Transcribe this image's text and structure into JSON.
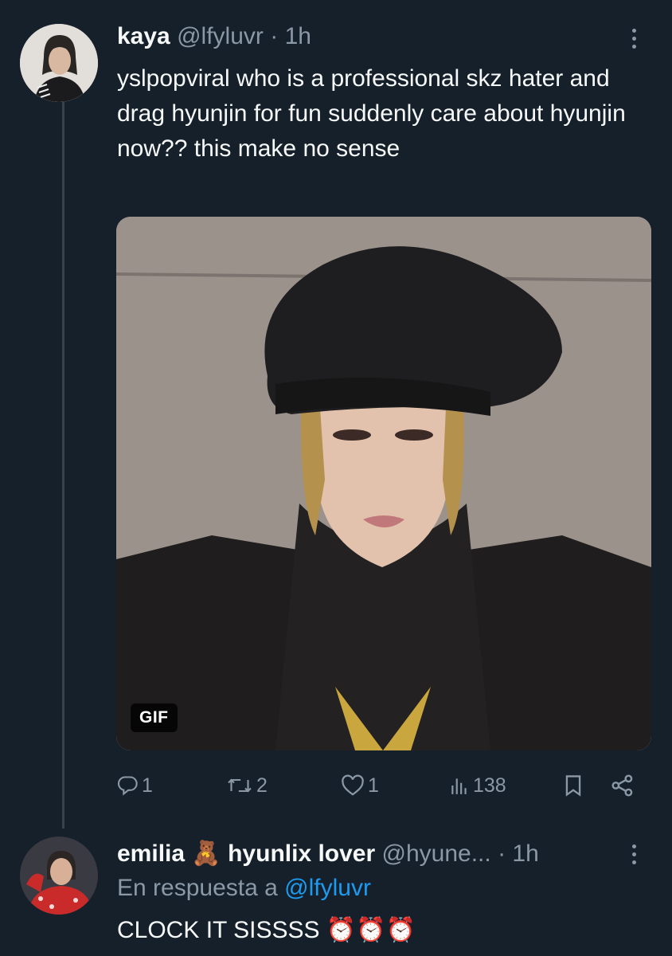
{
  "tweet1": {
    "name": "kaya",
    "handle": "@lfyluvr",
    "separator": "·",
    "time": "1h",
    "text": "yslpopviral who is a professional skz hater and drag hyunjin for fun suddenly care about hyunjin now?? this make no sense",
    "media_badge": "GIF",
    "actions": {
      "replies": "1",
      "reposts": "2",
      "likes": "1",
      "views": "138"
    }
  },
  "tweet2": {
    "name": "emilia",
    "name_emoji": "🧸",
    "name_suffix": "hyunlix lover",
    "handle": "@hyune...",
    "separator": "·",
    "time": "1h",
    "reply_prefix": "En respuesta a",
    "reply_to": "@lfyluvr",
    "text": "CLOCK IT SISSSS",
    "emojis": "⏰⏰⏰"
  },
  "icons": {
    "reply": "reply-icon",
    "repost": "repost-icon",
    "like": "heart-icon",
    "views": "views-icon",
    "bookmark": "bookmark-icon",
    "share": "share-icon",
    "more": "more-icon"
  },
  "colors": {
    "background": "#15202b",
    "text": "#f7f9f9",
    "secondary": "#8b98a5",
    "link": "#1d9bf0"
  }
}
